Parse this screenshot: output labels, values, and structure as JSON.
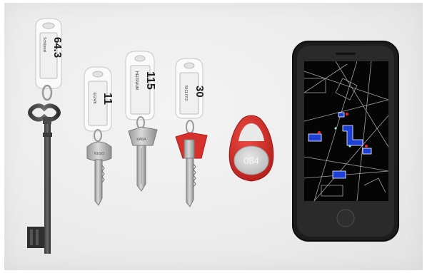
{
  "scene": {
    "background_color": "#ebebeb",
    "objects": [
      {
        "type": "skeleton-key",
        "tag_number": "64.3",
        "tag_sub": "Schlüssel",
        "tag_sub2": "Schrank"
      },
      {
        "type": "key",
        "tag_number": "11",
        "tag_sub": "EG/4/6"
      },
      {
        "type": "key",
        "tag_number": "115",
        "tag_sub": "HEIZRAUM"
      },
      {
        "type": "key",
        "tag_number": "30",
        "tag_sub": "5411 FF2",
        "cap_color": "#d8302c"
      },
      {
        "type": "rfid-fob",
        "label": "084",
        "color": "#d32b26"
      },
      {
        "type": "smartphone",
        "screen": "dark map with blue markers",
        "case_color": "#1c1c1c"
      }
    ]
  }
}
